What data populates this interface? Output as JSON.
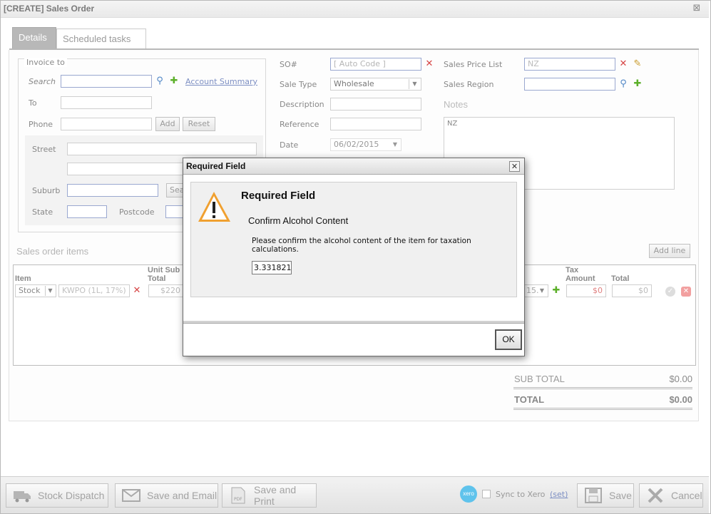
{
  "window": {
    "title": "[CREATE] Sales Order",
    "close_icon": "close-icon"
  },
  "tabs": [
    {
      "label": "Details",
      "active": true
    },
    {
      "label": "Scheduled tasks",
      "active": false
    }
  ],
  "invoice": {
    "legend": "Invoice to",
    "search_label": "Search",
    "account_summary": "Account Summary",
    "to_label": "To",
    "phone_label": "Phone",
    "add_btn": "Add",
    "reset_btn": "Reset",
    "street_label": "Street",
    "suburb_label": "Suburb",
    "search_btn": "Sea",
    "state_label": "State",
    "postcode_label": "Postcode"
  },
  "order": {
    "so_label": "SO#",
    "so_value": "[ Auto Code ]",
    "sale_type_label": "Sale Type",
    "sale_type_value": "Wholesale",
    "description_label": "Description",
    "reference_label": "Reference",
    "date_label": "Date",
    "date_value": "06/02/2015",
    "price_list_label": "Sales Price List",
    "price_list_value": "NZ",
    "region_label": "Sales Region",
    "notes_label": "Notes",
    "notes_value": "NZ"
  },
  "items": {
    "title": "Sales order items",
    "add_line": "Add line",
    "col_item": "Item",
    "col_unit_sub_1": "Unit Sub",
    "col_unit_sub_2": "Total",
    "col_tax_1": "Tax",
    "col_tax_2": "Amount",
    "col_total": "Total",
    "row": {
      "type": "Stock",
      "product": "KWPO (1L, 17%)",
      "unit_sub": "$220",
      "tax_code": "15.",
      "tax_amount": "$0",
      "total": "$0"
    }
  },
  "totals": {
    "sub_total_label": "SUB TOTAL",
    "sub_total_value": "$0.00",
    "total_label": "TOTAL",
    "total_value": "$0.00"
  },
  "footer": {
    "stock_dispatch": "Stock Dispatch",
    "save_email": "Save and Email",
    "save_print": "Save and Print",
    "xero_badge": "xero",
    "sync_label": "Sync to Xero",
    "sync_set": "(set)",
    "save": "Save",
    "cancel": "Cancel"
  },
  "modal": {
    "title": "Required Field",
    "heading": "Required Field",
    "subheading": "Confirm Alcohol Content",
    "message": "Please confirm the alcohol content of the item for taxation calculations.",
    "input_value": "3.331821",
    "ok": "OK",
    "icon": "warning-icon"
  },
  "colors": {
    "accent_link": "#7d8fc3",
    "tab_active": "#b8b8b8",
    "warning": "#f0a030"
  }
}
